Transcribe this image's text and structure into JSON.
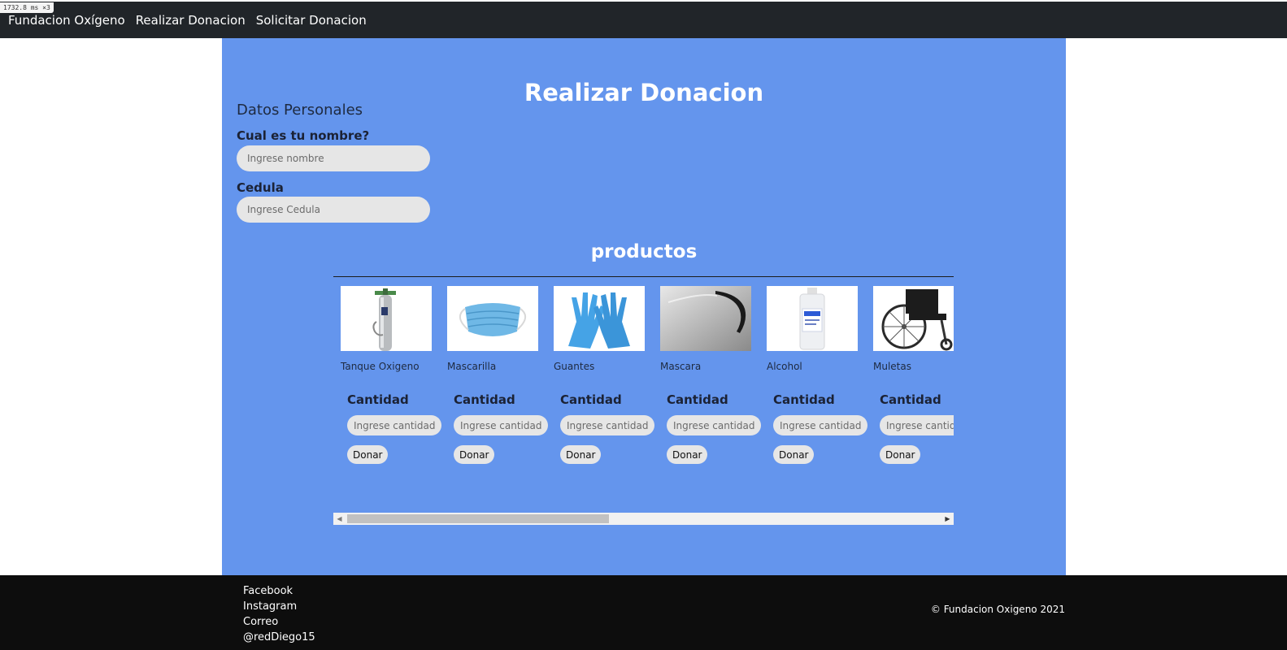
{
  "debug": {
    "timing": "1732.8 ms ×3"
  },
  "navbar": {
    "brand": "Fundacion Oxígeno",
    "links": [
      "Realizar Donacion",
      "Solicitar Donacion"
    ]
  },
  "main": {
    "title": "Realizar Donacion",
    "personal": {
      "section_title": "Datos Personales",
      "name_label": "Cual es tu nombre?",
      "name_placeholder": "Ingrese nombre",
      "id_label": "Cedula",
      "id_placeholder": "Ingrese Cedula"
    },
    "products": {
      "title": "productos",
      "quantity_label": "Cantidad",
      "quantity_placeholder": "Ingrese cantidad",
      "donate_label": "Donar",
      "items": [
        {
          "name": "Tanque Oxigeno",
          "icon": "oxygen-tank-image"
        },
        {
          "name": "Mascarilla",
          "icon": "face-mask-image"
        },
        {
          "name": "Guantes",
          "icon": "gloves-image"
        },
        {
          "name": "Mascara",
          "icon": "face-shield-image"
        },
        {
          "name": "Alcohol",
          "icon": "alcohol-bottle-image"
        },
        {
          "name": "Muletas",
          "icon": "wheelchair-image"
        }
      ]
    }
  },
  "footer": {
    "links": [
      "Facebook",
      "Instagram",
      "Correo",
      "@redDiego15"
    ],
    "copyright": "© Fundacion Oxigeno 2021"
  },
  "colors": {
    "navbar": "#212529",
    "main_panel": "#6495ed",
    "footer": "#0d0d0d",
    "input": "#e6e6e6"
  }
}
